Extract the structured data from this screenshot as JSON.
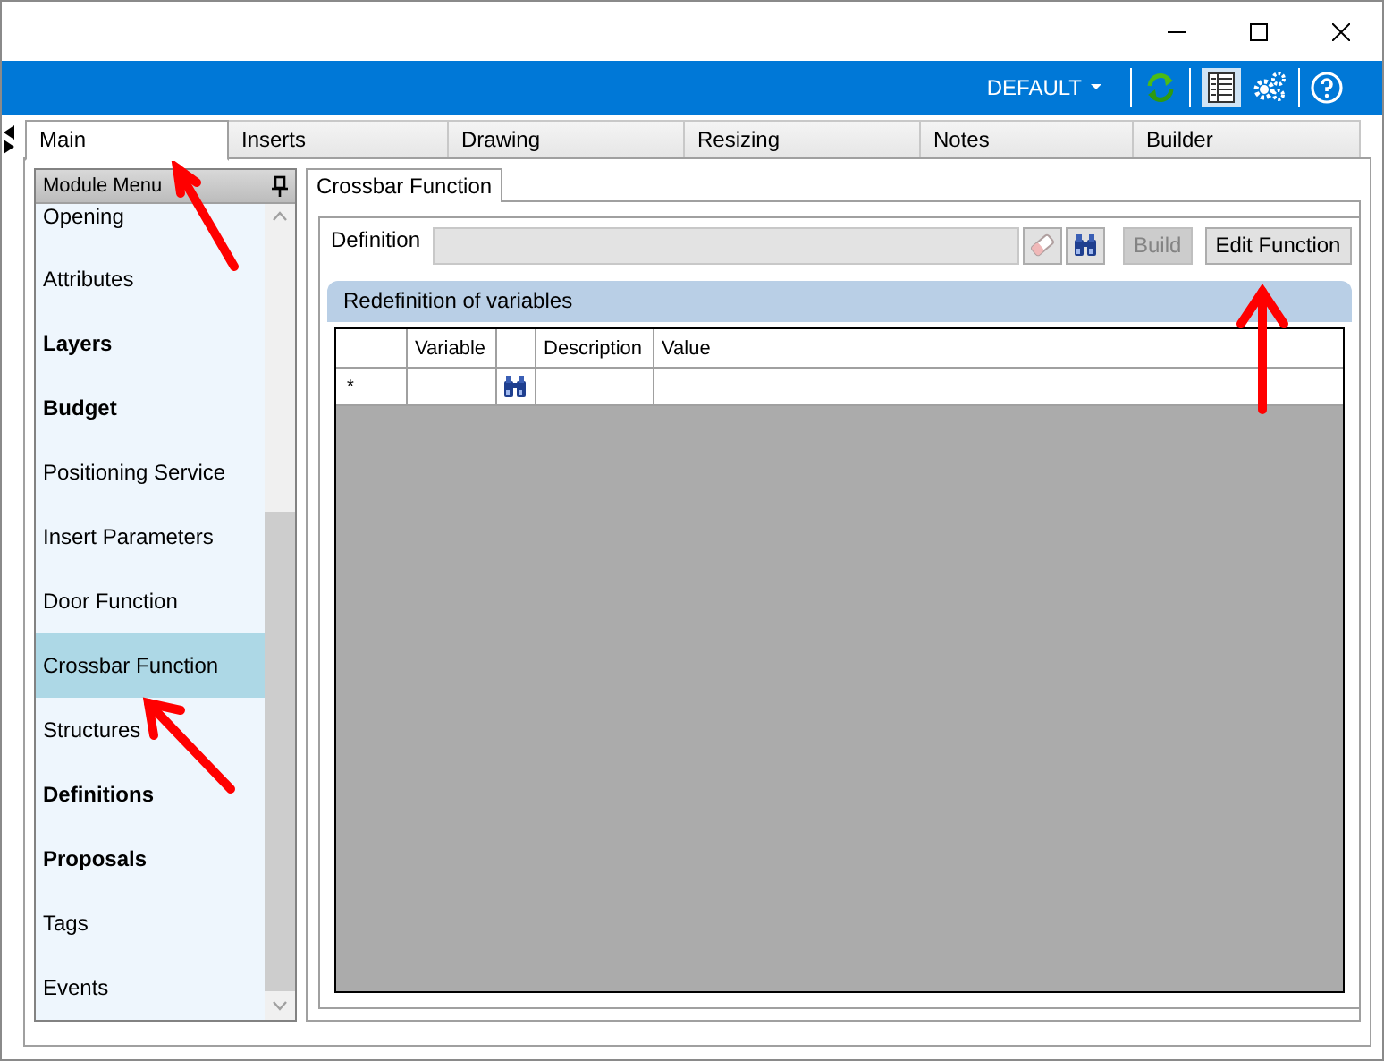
{
  "toolbar": {
    "profile": "DEFAULT"
  },
  "tabs": [
    {
      "label": "Main",
      "selected": true
    },
    {
      "label": "Inserts",
      "selected": false
    },
    {
      "label": "Drawing",
      "selected": false
    },
    {
      "label": "Resizing",
      "selected": false
    },
    {
      "label": "Notes",
      "selected": false
    },
    {
      "label": "Builder",
      "selected": false
    }
  ],
  "sidebar": {
    "title": "Module Menu",
    "items": [
      {
        "label": "Opening",
        "bold": false,
        "selected": false
      },
      {
        "label": "Attributes",
        "bold": false,
        "selected": false
      },
      {
        "label": "Layers",
        "bold": true,
        "selected": false
      },
      {
        "label": "Budget",
        "bold": true,
        "selected": false
      },
      {
        "label": "Positioning Service",
        "bold": false,
        "selected": false
      },
      {
        "label": "Insert Parameters",
        "bold": false,
        "selected": false
      },
      {
        "label": "Door Function",
        "bold": false,
        "selected": false
      },
      {
        "label": "Crossbar Function",
        "bold": false,
        "selected": true
      },
      {
        "label": "Structures",
        "bold": false,
        "selected": false
      },
      {
        "label": "Definitions",
        "bold": true,
        "selected": false
      },
      {
        "label": "Proposals",
        "bold": true,
        "selected": false
      },
      {
        "label": "Tags",
        "bold": false,
        "selected": false
      },
      {
        "label": "Events",
        "bold": false,
        "selected": false
      }
    ]
  },
  "panel": {
    "tab": "Crossbar Function",
    "definition": {
      "label": "Definition",
      "disabled": true
    },
    "buttons": [
      {
        "label": "Build",
        "disabled": true
      },
      {
        "label": "Edit Function",
        "disabled": false
      }
    ],
    "section_title": "Redefinition of variables",
    "table": {
      "columns": [
        "",
        "Variable",
        "",
        "Description",
        "Value"
      ],
      "new_row_marker": "*"
    }
  }
}
